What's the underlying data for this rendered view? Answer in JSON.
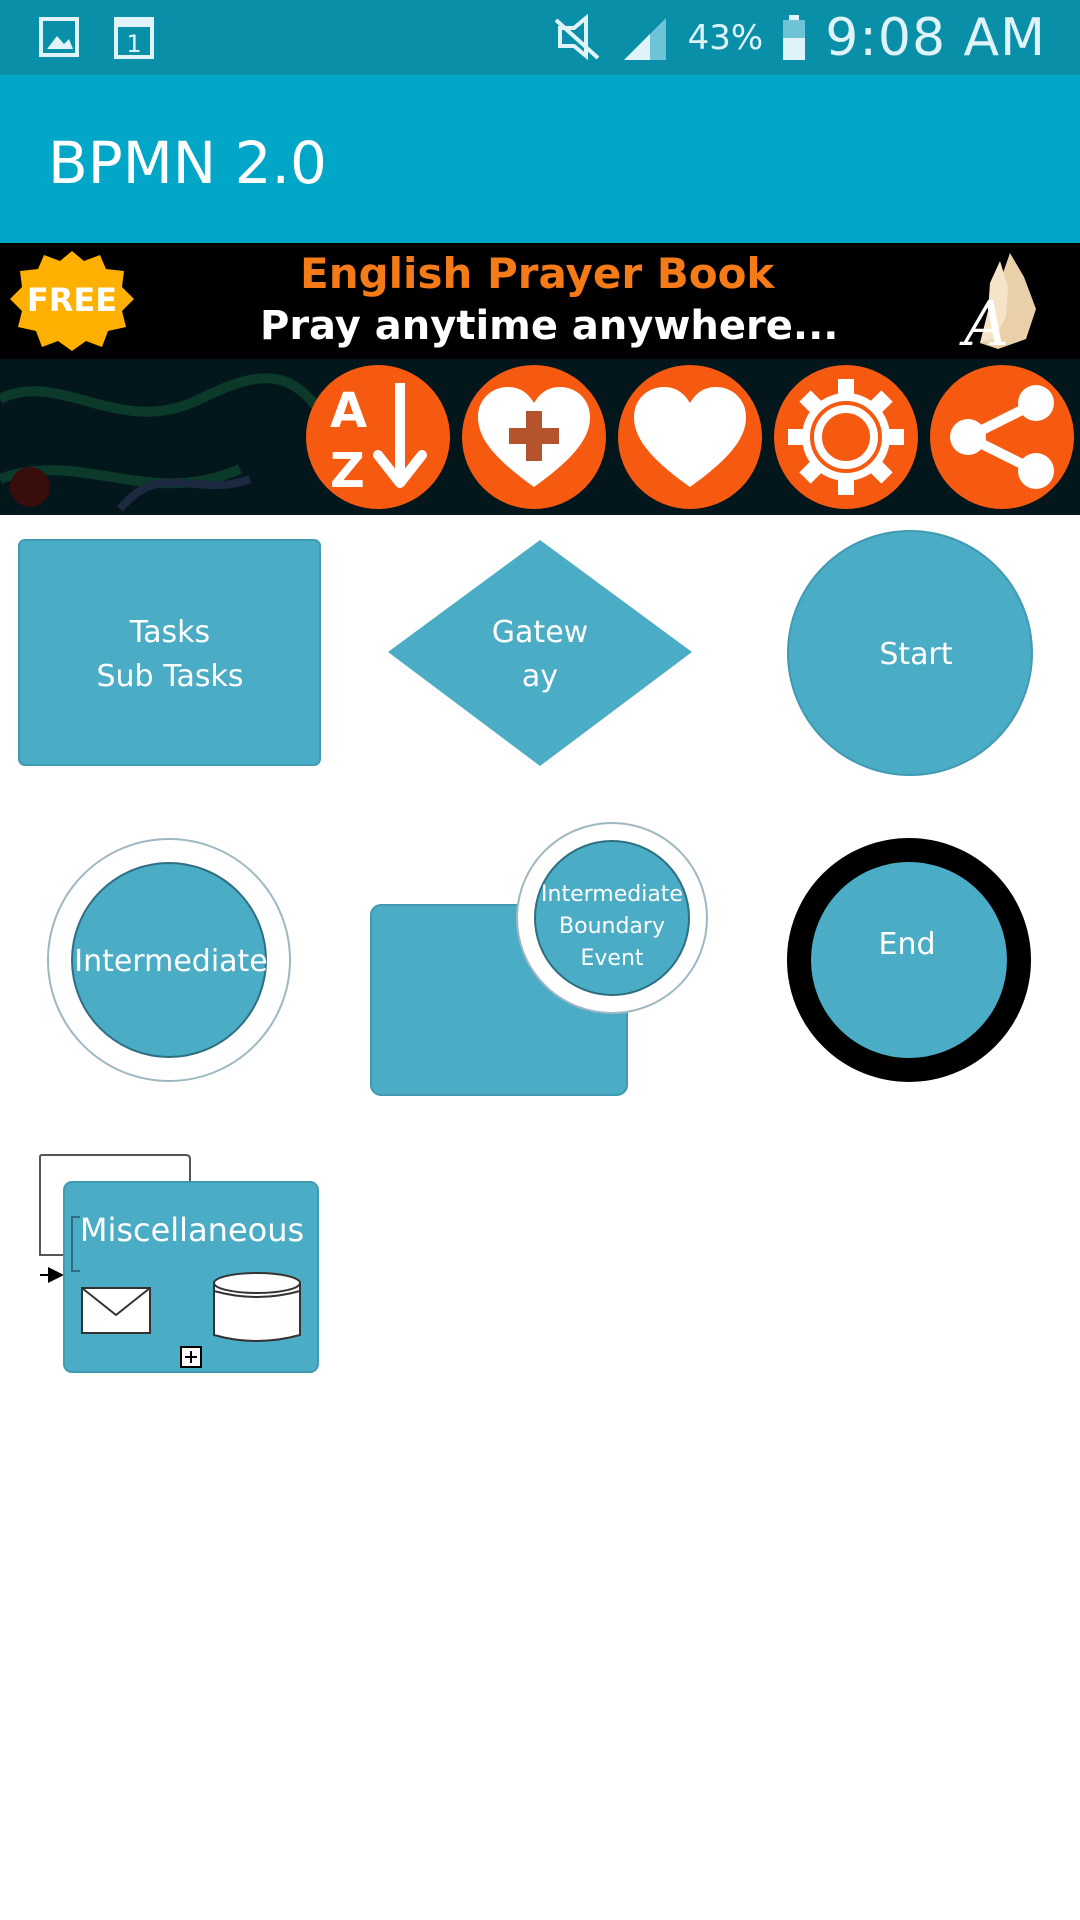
{
  "status_bar": {
    "battery": "43%",
    "time": "9:08 AM",
    "icons": [
      "gallery-icon",
      "calendar-icon",
      "mute-icon",
      "signal-icon",
      "battery-icon"
    ]
  },
  "app_bar": {
    "title": "BPMN 2.0"
  },
  "ad": {
    "badge": "FREE",
    "title": "English Prayer Book",
    "subtitle": "Pray anytime anywhere..."
  },
  "toolbar": {
    "buttons": [
      {
        "icon": "sort-az-icon",
        "letters": [
          "A",
          "Z"
        ]
      },
      {
        "icon": "add-favorite-icon"
      },
      {
        "icon": "favorites-icon"
      },
      {
        "icon": "settings-icon"
      },
      {
        "icon": "share-icon"
      }
    ]
  },
  "shapes": {
    "tasks": [
      "Tasks",
      "Sub Tasks"
    ],
    "gateway": [
      "Gatew",
      "ay"
    ],
    "start": "Start",
    "intermediate": "Intermediate",
    "boundary": [
      "Intermediate",
      "Boundary",
      "Event"
    ],
    "end": "End",
    "misc": "Miscellaneous"
  },
  "colors": {
    "status_bar": "#0a8fa9",
    "app_bar": "#02a6c6",
    "shape_fill": "#4bacc6",
    "toolbar_button": "#f55a10"
  }
}
